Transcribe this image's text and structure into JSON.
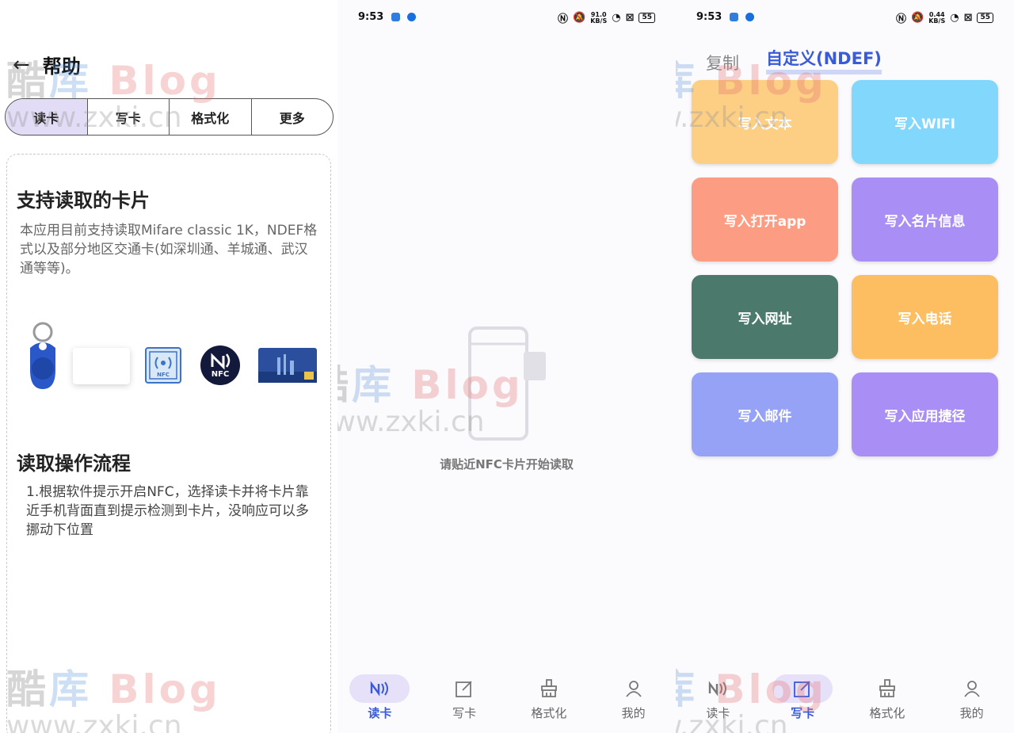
{
  "watermark": {
    "top_a": "酷",
    "top_b": "库",
    "top_c": "Blog",
    "bottom": "www.zxki.cn"
  },
  "status": {
    "time": "9:53",
    "speed_left": {
      "value": "91.0",
      "unit": "KB/S"
    },
    "speed_right": {
      "value": "0.44",
      "unit": "KB/S"
    },
    "battery": "55",
    "app_colors": [
      "#2f7de1",
      "#1a6fe0"
    ]
  },
  "help": {
    "back_icon": "arrow-left-icon",
    "title": "帮助",
    "tabs": [
      "读卡",
      "写卡",
      "格式化",
      "更多"
    ],
    "section1": {
      "title": "支持读取的卡片",
      "text": "本应用目前支持读取Mifare classic 1K，NDEF格式以及部分地区交通卡(如深圳通、羊城通、武汉通等等)。"
    },
    "card_label": "NFC",
    "section2": {
      "title": "读取操作流程",
      "text": "1.根据软件提示开启NFC，选择读卡并将卡片靠近手机背面直到提示检测到卡片，没响应可以多挪动下位置"
    }
  },
  "reader": {
    "hint": "请贴近NFC卡片开始读取"
  },
  "nav": {
    "items": [
      {
        "label": "读卡",
        "icon": "nfc-icon"
      },
      {
        "label": "写卡",
        "icon": "edit-icon"
      },
      {
        "label": "格式化",
        "icon": "broom-icon"
      },
      {
        "label": "我的",
        "icon": "user-icon"
      }
    ],
    "active_color": "#3a5bd9"
  },
  "writer": {
    "tabs": [
      "复制",
      "自定义(NDEF)"
    ],
    "tiles": [
      {
        "label": "写入文本",
        "color": "#fdcf85"
      },
      {
        "label": "写入WIFI",
        "color": "#82d8fc"
      },
      {
        "label": "写入打开app",
        "color": "#fc9c82"
      },
      {
        "label": "写入名片信息",
        "color": "#a98ff5"
      },
      {
        "label": "写入网址",
        "color": "#4b7a6c"
      },
      {
        "label": "写入电话",
        "color": "#fdbe62"
      },
      {
        "label": "写入邮件",
        "color": "#95a2f6"
      },
      {
        "label": "写入应用捷径",
        "color": "#a98ff5"
      }
    ]
  }
}
